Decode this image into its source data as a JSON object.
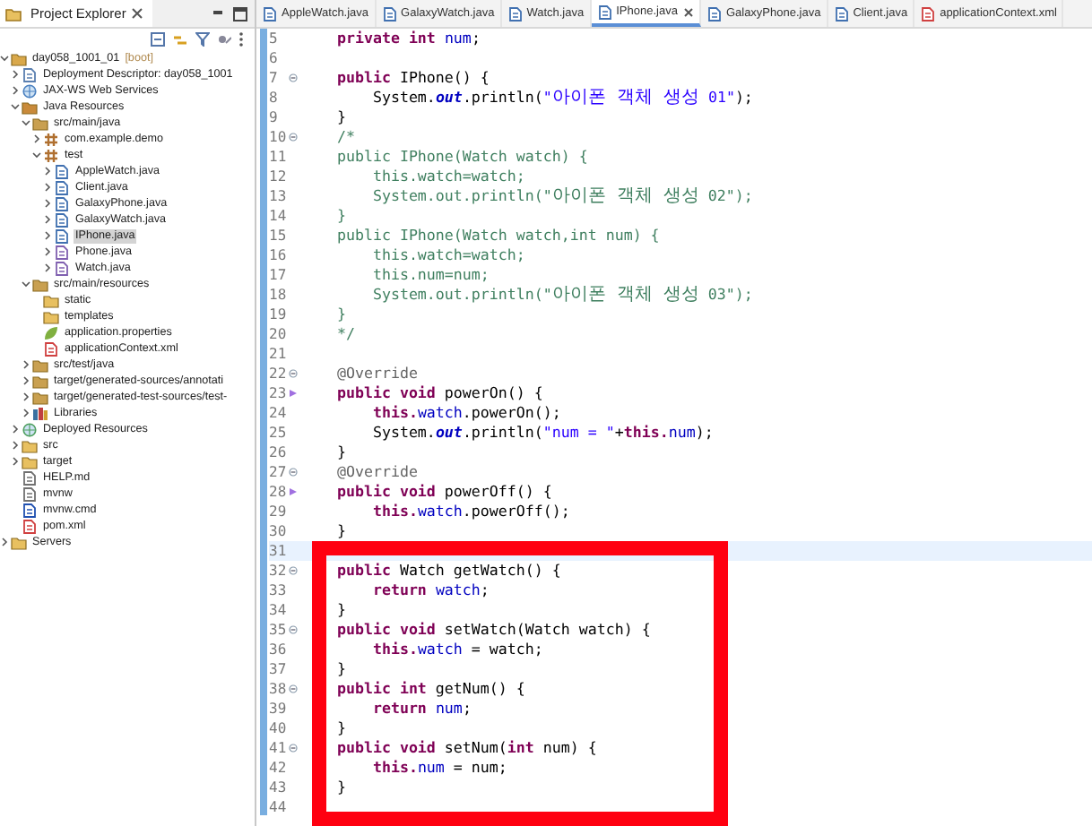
{
  "explorer": {
    "title": "Project Explorer",
    "tree": [
      {
        "label": "day058_1001_01",
        "decoration": "[boot]",
        "kind": "project",
        "expanded": true,
        "selected": false,
        "children": [
          {
            "label": "Deployment Descriptor: day058_1001",
            "kind": "descriptor",
            "expanded": false,
            "selected": false
          },
          {
            "label": "JAX-WS Web Services",
            "kind": "webservice",
            "expanded": false,
            "selected": false
          },
          {
            "label": "Java Resources",
            "kind": "resources",
            "expanded": true,
            "selected": false,
            "children": [
              {
                "label": "src/main/java",
                "kind": "srcfolder",
                "expanded": true,
                "selected": false,
                "children": [
                  {
                    "label": "com.example.demo",
                    "kind": "package",
                    "expanded": false,
                    "selected": false
                  },
                  {
                    "label": "test",
                    "kind": "package",
                    "expanded": true,
                    "selected": false,
                    "children": [
                      {
                        "label": "AppleWatch.java",
                        "kind": "java",
                        "expanded": false,
                        "selected": false
                      },
                      {
                        "label": "Client.java",
                        "kind": "java",
                        "expanded": false,
                        "selected": false
                      },
                      {
                        "label": "GalaxyPhone.java",
                        "kind": "java",
                        "expanded": false,
                        "selected": false
                      },
                      {
                        "label": "GalaxyWatch.java",
                        "kind": "java",
                        "expanded": false,
                        "selected": false
                      },
                      {
                        "label": "IPhone.java",
                        "kind": "java",
                        "expanded": false,
                        "selected": true
                      },
                      {
                        "label": "Phone.java",
                        "kind": "interface",
                        "expanded": false,
                        "selected": false
                      },
                      {
                        "label": "Watch.java",
                        "kind": "interface",
                        "expanded": false,
                        "selected": false
                      }
                    ]
                  }
                ]
              },
              {
                "label": "src/main/resources",
                "kind": "srcfolder",
                "expanded": true,
                "selected": false,
                "children": [
                  {
                    "label": "static",
                    "kind": "folder",
                    "selected": false
                  },
                  {
                    "label": "templates",
                    "kind": "folder",
                    "selected": false
                  },
                  {
                    "label": "application.properties",
                    "kind": "properties",
                    "selected": false
                  },
                  {
                    "label": "applicationContext.xml",
                    "kind": "xml",
                    "selected": false
                  }
                ]
              },
              {
                "label": "src/test/java",
                "kind": "srcfolder",
                "expanded": false,
                "selected": false
              },
              {
                "label": "target/generated-sources/annotati",
                "kind": "srcfolder",
                "expanded": false,
                "selected": false
              },
              {
                "label": "target/generated-test-sources/test-",
                "kind": "srcfolder",
                "expanded": false,
                "selected": false
              },
              {
                "label": "Libraries",
                "kind": "libraries",
                "expanded": false,
                "selected": false
              }
            ]
          },
          {
            "label": "Deployed Resources",
            "kind": "deployed",
            "expanded": false,
            "selected": false
          },
          {
            "label": "src",
            "kind": "folder",
            "expanded": false,
            "selected": false
          },
          {
            "label": "target",
            "kind": "folder",
            "expanded": false,
            "selected": false
          },
          {
            "label": "HELP.md",
            "kind": "file",
            "selected": false
          },
          {
            "label": "mvnw",
            "kind": "file",
            "selected": false
          },
          {
            "label": "mvnw.cmd",
            "kind": "script",
            "selected": false
          },
          {
            "label": "pom.xml",
            "kind": "xml",
            "selected": false
          }
        ]
      },
      {
        "label": "Servers",
        "kind": "folder",
        "expanded": false,
        "selected": false
      }
    ]
  },
  "editor": {
    "tabs": [
      {
        "label": "AppleWatch.java",
        "kind": "java",
        "selected": false
      },
      {
        "label": "GalaxyWatch.java",
        "kind": "java",
        "selected": false
      },
      {
        "label": "Watch.java",
        "kind": "java",
        "selected": false
      },
      {
        "label": "IPhone.java",
        "kind": "java",
        "selected": true
      },
      {
        "label": "GalaxyPhone.java",
        "kind": "java",
        "selected": false
      },
      {
        "label": "Client.java",
        "kind": "java",
        "selected": false
      },
      {
        "label": "applicationContext.xml",
        "kind": "xml",
        "selected": false
      }
    ],
    "lines": [
      {
        "number": "5",
        "fold": false,
        "override": false,
        "current": false,
        "tokens": [
          {
            "kind": "keyword",
            "text": "    private int "
          },
          {
            "kind": "field",
            "text": "num"
          },
          {
            "kind": "plain",
            "text": ";"
          }
        ]
      },
      {
        "number": "6",
        "fold": false,
        "override": false,
        "current": false
      },
      {
        "number": "7",
        "fold": true,
        "override": false,
        "current": false,
        "tokens": [
          {
            "kind": "keyword",
            "text": "    public"
          },
          {
            "kind": "plain",
            "text": " IPhone() {"
          }
        ]
      },
      {
        "number": "8",
        "fold": false,
        "override": false,
        "current": false,
        "tokens": [
          {
            "kind": "plain",
            "text": "        System."
          },
          {
            "kind": "static",
            "text": "out"
          },
          {
            "kind": "plain",
            "text": ".println("
          },
          {
            "kind": "string",
            "text": "\""
          },
          {
            "kind": "string",
            "text": "아이폰 객체 생성",
            "hangul": true
          },
          {
            "kind": "string",
            "text": " 01\""
          },
          {
            "kind": "plain",
            "text": ");"
          }
        ]
      },
      {
        "number": "9",
        "fold": false,
        "override": false,
        "current": false,
        "tokens": [
          {
            "kind": "plain",
            "text": "    }"
          }
        ]
      },
      {
        "number": "10",
        "fold": true,
        "override": false,
        "current": false,
        "tokens": [
          {
            "kind": "comment",
            "text": "    /*"
          }
        ]
      },
      {
        "number": "11",
        "fold": false,
        "override": false,
        "current": false,
        "tokens": [
          {
            "kind": "comment",
            "text": "    public IPhone(Watch watch) {"
          }
        ]
      },
      {
        "number": "12",
        "fold": false,
        "override": false,
        "current": false,
        "tokens": [
          {
            "kind": "comment",
            "text": "        this.watch=watch;"
          }
        ]
      },
      {
        "number": "13",
        "fold": false,
        "override": false,
        "current": false,
        "tokens": [
          {
            "kind": "comment",
            "text": "        System.out.println(\""
          },
          {
            "kind": "comment",
            "text": "아이폰 객체 생성",
            "hangul": true
          },
          {
            "kind": "comment",
            "text": " 02\");"
          }
        ]
      },
      {
        "number": "14",
        "fold": false,
        "override": false,
        "current": false,
        "tokens": [
          {
            "kind": "comment",
            "text": "    }"
          }
        ]
      },
      {
        "number": "15",
        "fold": false,
        "override": false,
        "current": false,
        "tokens": [
          {
            "kind": "comment",
            "text": "    public IPhone(Watch watch,int num) {"
          }
        ]
      },
      {
        "number": "16",
        "fold": false,
        "override": false,
        "current": false,
        "tokens": [
          {
            "kind": "comment",
            "text": "        this.watch=watch;"
          }
        ]
      },
      {
        "number": "17",
        "fold": false,
        "override": false,
        "current": false,
        "tokens": [
          {
            "kind": "comment",
            "text": "        this.num=num;"
          }
        ]
      },
      {
        "number": "18",
        "fold": false,
        "override": false,
        "current": false,
        "tokens": [
          {
            "kind": "comment",
            "text": "        System.out.println(\""
          },
          {
            "kind": "comment",
            "text": "아이폰 객체 생성",
            "hangul": true
          },
          {
            "kind": "comment",
            "text": " 03\");"
          }
        ]
      },
      {
        "number": "19",
        "fold": false,
        "override": false,
        "current": false,
        "tokens": [
          {
            "kind": "comment",
            "text": "    }"
          }
        ]
      },
      {
        "number": "20",
        "fold": false,
        "override": false,
        "current": false,
        "tokens": [
          {
            "kind": "comment",
            "text": "    */"
          }
        ]
      },
      {
        "number": "21",
        "fold": false,
        "override": false,
        "current": false
      },
      {
        "number": "22",
        "fold": true,
        "override": false,
        "current": false,
        "tokens": [
          {
            "kind": "annotation",
            "text": "    @Override"
          }
        ]
      },
      {
        "number": "23",
        "fold": false,
        "override": true,
        "current": false,
        "tokens": [
          {
            "kind": "keyword",
            "text": "    public void"
          },
          {
            "kind": "plain",
            "text": " powerOn() {"
          }
        ]
      },
      {
        "number": "24",
        "fold": false,
        "override": false,
        "current": false,
        "tokens": [
          {
            "kind": "keyword",
            "text": "        this."
          },
          {
            "kind": "field",
            "text": "watch"
          },
          {
            "kind": "plain",
            "text": ".powerOn();"
          }
        ]
      },
      {
        "number": "25",
        "fold": false,
        "override": false,
        "current": false,
        "tokens": [
          {
            "kind": "plain",
            "text": "        System."
          },
          {
            "kind": "static",
            "text": "out"
          },
          {
            "kind": "plain",
            "text": ".println("
          },
          {
            "kind": "string",
            "text": "\"num = \""
          },
          {
            "kind": "plain",
            "text": "+"
          },
          {
            "kind": "keyword",
            "text": "this."
          },
          {
            "kind": "field",
            "text": "num"
          },
          {
            "kind": "plain",
            "text": ");"
          }
        ]
      },
      {
        "number": "26",
        "fold": false,
        "override": false,
        "current": false,
        "tokens": [
          {
            "kind": "plain",
            "text": "    }"
          }
        ]
      },
      {
        "number": "27",
        "fold": true,
        "override": false,
        "current": false,
        "tokens": [
          {
            "kind": "annotation",
            "text": "    @Override"
          }
        ]
      },
      {
        "number": "28",
        "fold": false,
        "override": true,
        "current": false,
        "tokens": [
          {
            "kind": "keyword",
            "text": "    public void"
          },
          {
            "kind": "plain",
            "text": " powerOff() {"
          }
        ]
      },
      {
        "number": "29",
        "fold": false,
        "override": false,
        "current": false,
        "tokens": [
          {
            "kind": "keyword",
            "text": "        this."
          },
          {
            "kind": "field",
            "text": "watch"
          },
          {
            "kind": "plain",
            "text": ".powerOff();"
          }
        ]
      },
      {
        "number": "30",
        "fold": false,
        "override": false,
        "current": false,
        "tokens": [
          {
            "kind": "plain",
            "text": "    }"
          }
        ]
      },
      {
        "number": "31",
        "fold": false,
        "override": false,
        "current": true
      },
      {
        "number": "32",
        "fold": true,
        "override": false,
        "current": false,
        "tokens": [
          {
            "kind": "keyword",
            "text": "    public"
          },
          {
            "kind": "plain",
            "text": " Watch getWatch() {"
          }
        ]
      },
      {
        "number": "33",
        "fold": false,
        "override": false,
        "current": false,
        "tokens": [
          {
            "kind": "keyword",
            "text": "        return "
          },
          {
            "kind": "field",
            "text": "watch"
          },
          {
            "kind": "plain",
            "text": ";"
          }
        ]
      },
      {
        "number": "34",
        "fold": false,
        "override": false,
        "current": false,
        "tokens": [
          {
            "kind": "plain",
            "text": "    }"
          }
        ]
      },
      {
        "number": "35",
        "fold": true,
        "override": false,
        "current": false,
        "tokens": [
          {
            "kind": "keyword",
            "text": "    public void"
          },
          {
            "kind": "plain",
            "text": " setWatch(Watch watch) {"
          }
        ]
      },
      {
        "number": "36",
        "fold": false,
        "override": false,
        "current": false,
        "tokens": [
          {
            "kind": "keyword",
            "text": "        this."
          },
          {
            "kind": "field",
            "text": "watch"
          },
          {
            "kind": "plain",
            "text": " = watch;"
          }
        ]
      },
      {
        "number": "37",
        "fold": false,
        "override": false,
        "current": false,
        "tokens": [
          {
            "kind": "plain",
            "text": "    }"
          }
        ]
      },
      {
        "number": "38",
        "fold": true,
        "override": false,
        "current": false,
        "tokens": [
          {
            "kind": "keyword",
            "text": "    public int"
          },
          {
            "kind": "plain",
            "text": " getNum() {"
          }
        ]
      },
      {
        "number": "39",
        "fold": false,
        "override": false,
        "current": false,
        "tokens": [
          {
            "kind": "keyword",
            "text": "        return "
          },
          {
            "kind": "field",
            "text": "num"
          },
          {
            "kind": "plain",
            "text": ";"
          }
        ]
      },
      {
        "number": "40",
        "fold": false,
        "override": false,
        "current": false,
        "tokens": [
          {
            "kind": "plain",
            "text": "    }"
          }
        ]
      },
      {
        "number": "41",
        "fold": true,
        "override": false,
        "current": false,
        "tokens": [
          {
            "kind": "keyword",
            "text": "    public void"
          },
          {
            "kind": "plain",
            "text": " setNum("
          },
          {
            "kind": "keyword",
            "text": "int"
          },
          {
            "kind": "plain",
            "text": " num) {"
          }
        ]
      },
      {
        "number": "42",
        "fold": false,
        "override": false,
        "current": false,
        "tokens": [
          {
            "kind": "keyword",
            "text": "        this."
          },
          {
            "kind": "field",
            "text": "num"
          },
          {
            "kind": "plain",
            "text": " = num;"
          }
        ]
      },
      {
        "number": "43",
        "fold": false,
        "override": false,
        "current": false,
        "tokens": [
          {
            "kind": "plain",
            "text": "    }"
          }
        ]
      },
      {
        "number": "44",
        "fold": false,
        "override": false,
        "current": false
      }
    ]
  }
}
